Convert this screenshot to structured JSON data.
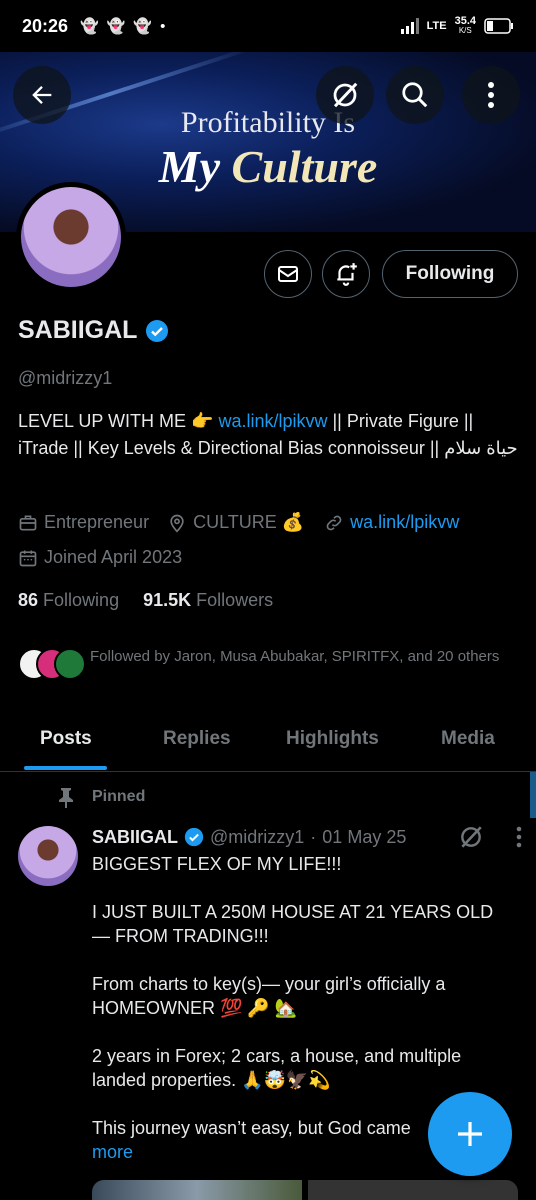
{
  "status_bar": {
    "time": "20:26",
    "network": "LTE",
    "speed_value": "35.4",
    "speed_unit": "K/S"
  },
  "banner": {
    "line1": "Profitability Is",
    "line2_part1": "My ",
    "line2_part2": "Culture"
  },
  "profile": {
    "name": "SABIIGAL",
    "handle": "@midrizzy1",
    "following_button": "Following",
    "bio_part1": "LEVEL UP WITH ME 👉 ",
    "bio_link": "wa.link/lpikvw",
    "bio_part2": " || Private Figure || iTrade || Key Levels & Directional Bias connoisseur || حياة سلام",
    "category": "Entrepreneur",
    "location": "CULTURE 💰",
    "website": "wa.link/lpikvw",
    "joined": "Joined April 2023",
    "following_count": "86",
    "following_label": "Following",
    "followers_count": "91.5K",
    "followers_label": "Followers",
    "followed_by": "Followed by Jaron, Musa Abubakar, SPIRITFX, and 20 others"
  },
  "tabs": [
    "Posts",
    "Replies",
    "Highlights",
    "Media"
  ],
  "pinned_post": {
    "pinned_label": "Pinned",
    "author_name": "SABIIGAL",
    "author_handle": "@midrizzy1",
    "separator": "·",
    "date": "01 May 25",
    "para1": "BIGGEST FLEX OF MY LIFE!!!",
    "para2": "I JUST BUILT A 250M HOUSE AT 21 YEARS OLD — FROM TRADING!!!",
    "para3": "From charts to key(s)— your girl’s officially a HOMEOWNER 💯 🔑 🏡",
    "para4": "2 years in Forex; 2 cars, a house, and multiple landed properties. 🙏🤯🦅💫",
    "para5": "This journey wasn’t easy, but God came",
    "more": "more"
  },
  "colors": {
    "background": "#000000",
    "accent": "#1d9bf0",
    "secondary_text": "#71767b",
    "border": "#2f3336"
  }
}
